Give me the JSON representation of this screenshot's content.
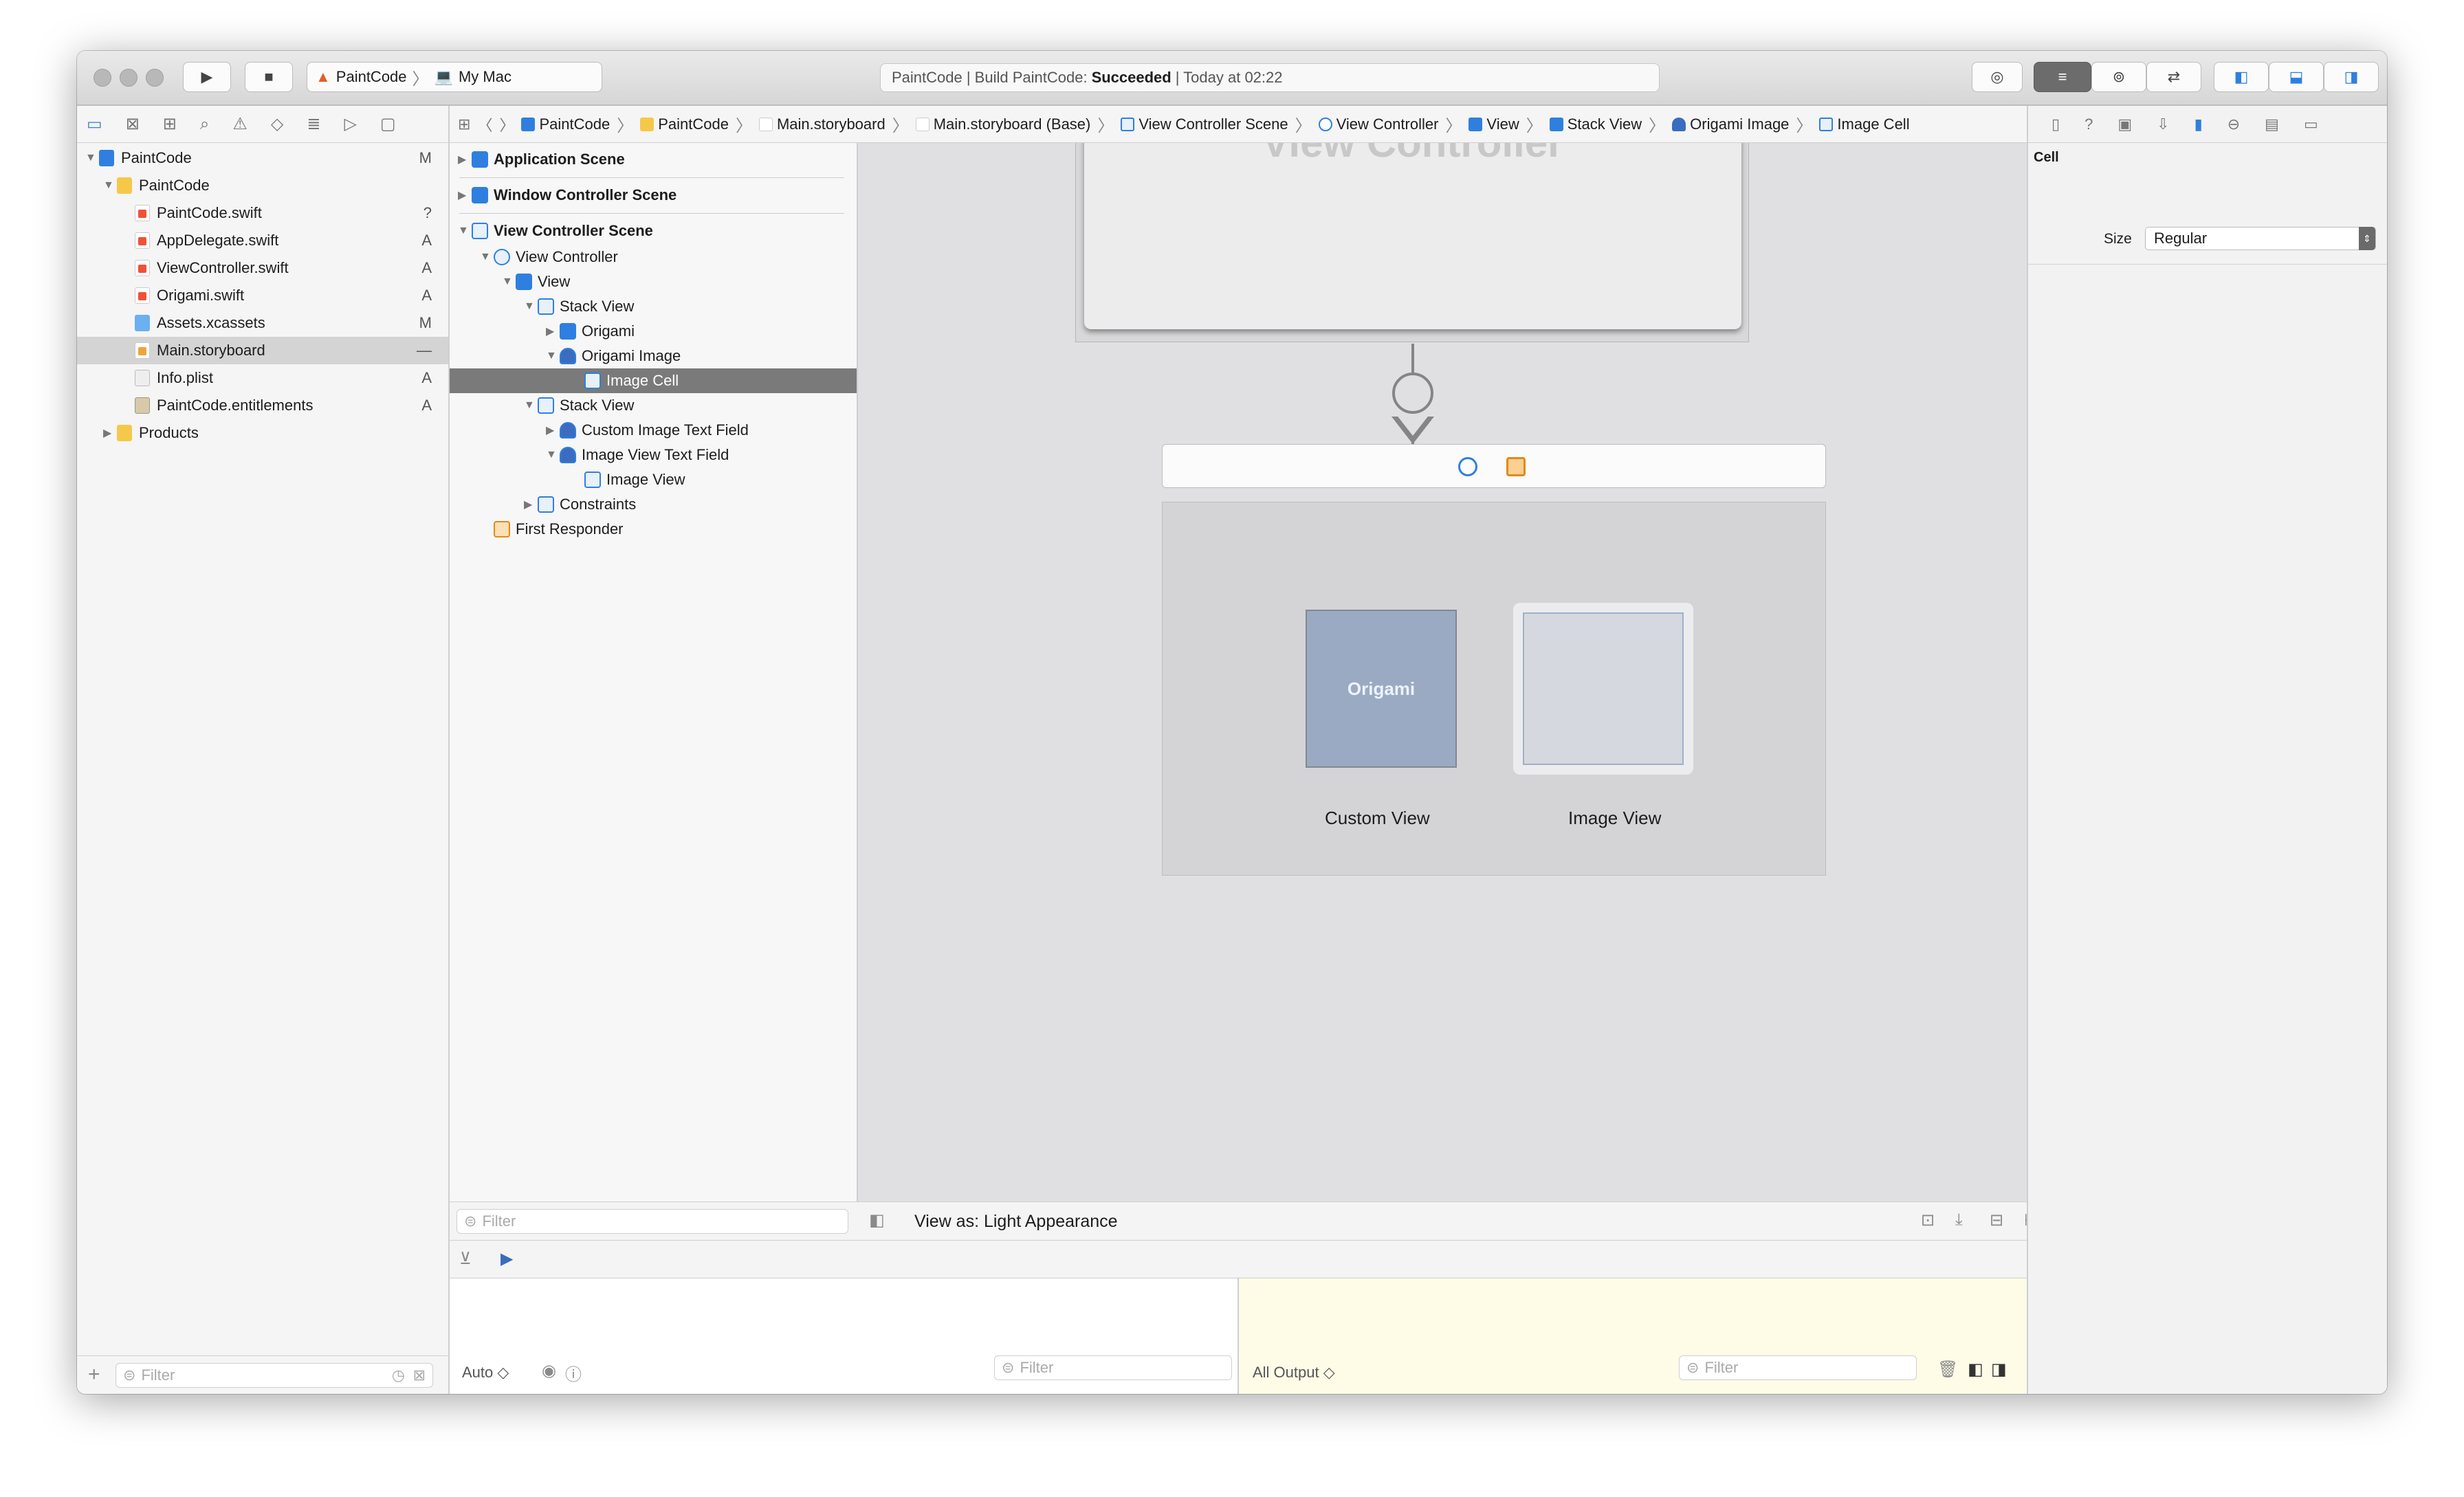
{
  "toolbar": {
    "scheme": "PaintCode",
    "destination": "My Mac",
    "status_prefix": "PaintCode | Build PaintCode:",
    "status_result": "Succeeded",
    "status_suffix": "| Today at 02:22"
  },
  "navigator": {
    "items": [
      {
        "label": "PaintCode",
        "badge": "M"
      },
      {
        "label": "PaintCode",
        "badge": ""
      },
      {
        "label": "PaintCode.swift",
        "badge": "?"
      },
      {
        "label": "AppDelegate.swift",
        "badge": "A"
      },
      {
        "label": "ViewController.swift",
        "badge": "A"
      },
      {
        "label": "Origami.swift",
        "badge": "A"
      },
      {
        "label": "Assets.xcassets",
        "badge": "M"
      },
      {
        "label": "Main.storyboard",
        "badge": "—"
      },
      {
        "label": "Info.plist",
        "badge": "A"
      },
      {
        "label": "PaintCode.entitlements",
        "badge": "A"
      },
      {
        "label": "Products",
        "badge": ""
      }
    ],
    "filter_placeholder": "Filter"
  },
  "jumpbar": {
    "crumbs": [
      "PaintCode",
      "PaintCode",
      "Main.storyboard",
      "Main.storyboard (Base)",
      "View Controller Scene",
      "View Controller",
      "View",
      "Stack View",
      "Origami Image",
      "Image Cell"
    ]
  },
  "outline": {
    "items": [
      "Application Scene",
      "Window Controller Scene",
      "View Controller Scene",
      "View Controller",
      "View",
      "Stack View",
      "Origami",
      "Origami Image",
      "Image Cell",
      "Stack View",
      "Custom Image Text Field",
      "Image View Text Field",
      "Image View",
      "Constraints",
      "First Responder"
    ],
    "filter_placeholder": "Filter"
  },
  "canvas": {
    "vc_title": "View Controller",
    "origami_label": "Origami",
    "custom_view_label": "Custom View",
    "image_view_label": "Image View",
    "view_as": "View as: Light Appearance"
  },
  "inspector": {
    "section": "Cell",
    "size_label": "Size",
    "size_value": "Regular"
  },
  "debug": {
    "auto_label": "Auto ◇",
    "vars_filter": "Filter",
    "output_label": "All Output ◇",
    "console_filter": "Filter"
  }
}
